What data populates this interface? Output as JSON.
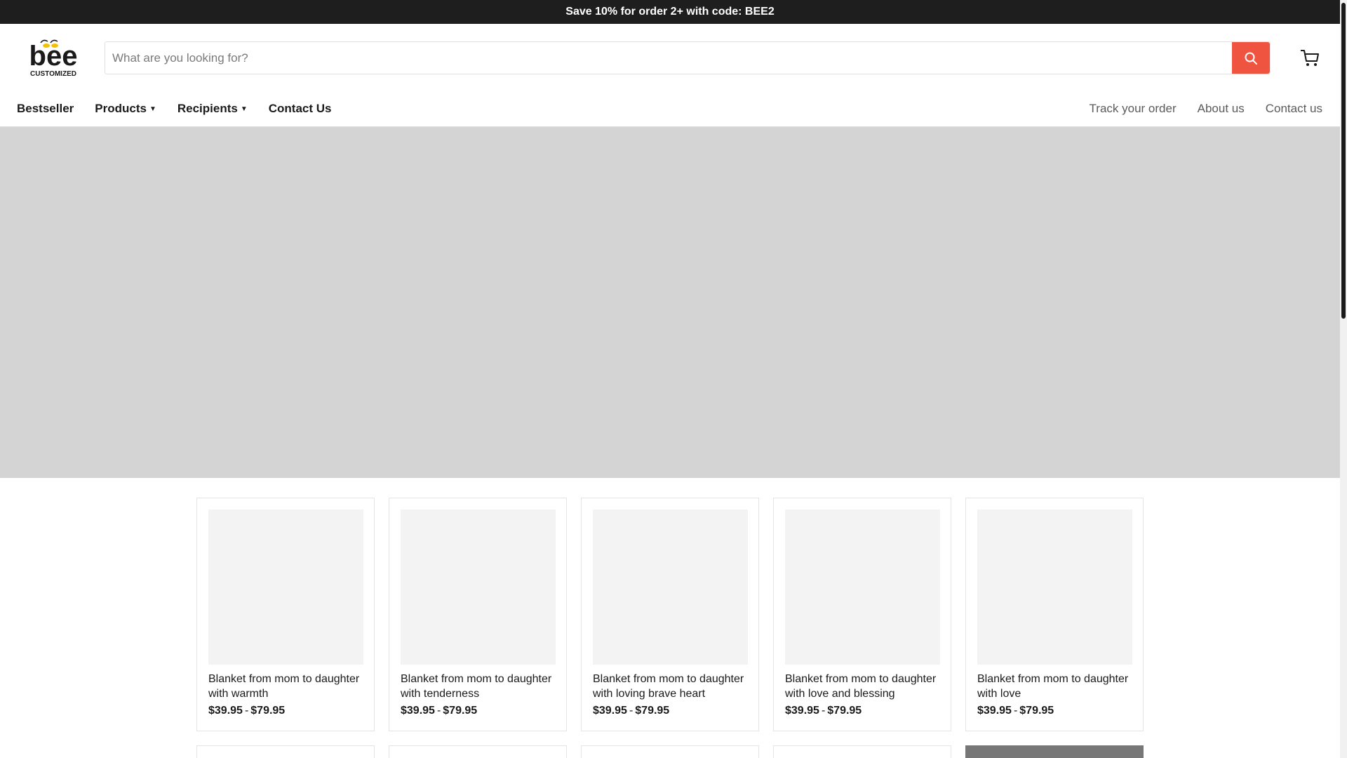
{
  "announcement": {
    "text": "Save 10% for order 2+ with code: BEE2"
  },
  "brand": {
    "logo_text": "bee",
    "logo_subtext": "CUSTOMIZED",
    "accent_color": "#ef5440",
    "bee_color": "#f2c200"
  },
  "search": {
    "placeholder": "What are you looking for?",
    "icon": "search-icon"
  },
  "cart": {
    "icon": "cart-icon"
  },
  "nav": {
    "left": [
      {
        "label": "Bestseller",
        "has_dropdown": false
      },
      {
        "label": "Products",
        "has_dropdown": true
      },
      {
        "label": "Recipients",
        "has_dropdown": true
      },
      {
        "label": "Contact Us",
        "has_dropdown": false
      }
    ],
    "right": [
      {
        "label": "Track your order"
      },
      {
        "label": "About us"
      },
      {
        "label": "Contact us"
      }
    ]
  },
  "products": [
    {
      "title": "Blanket from mom to daughter with warmth",
      "price_min": "$39.95",
      "price_sep": "-",
      "price_max": "$79.95"
    },
    {
      "title": "Blanket from mom to daughter with tenderness",
      "price_min": "$39.95",
      "price_sep": "-",
      "price_max": "$79.95"
    },
    {
      "title": "Blanket from mom to daughter with loving brave heart",
      "price_min": "$39.95",
      "price_sep": "-",
      "price_max": "$79.95"
    },
    {
      "title": "Blanket from mom to daughter with love and blessing",
      "price_min": "$39.95",
      "price_sep": "-",
      "price_max": "$79.95"
    },
    {
      "title": "Blanket from mom to daughter with love",
      "price_min": "$39.95",
      "price_sep": "-",
      "price_max": "$79.95"
    }
  ]
}
